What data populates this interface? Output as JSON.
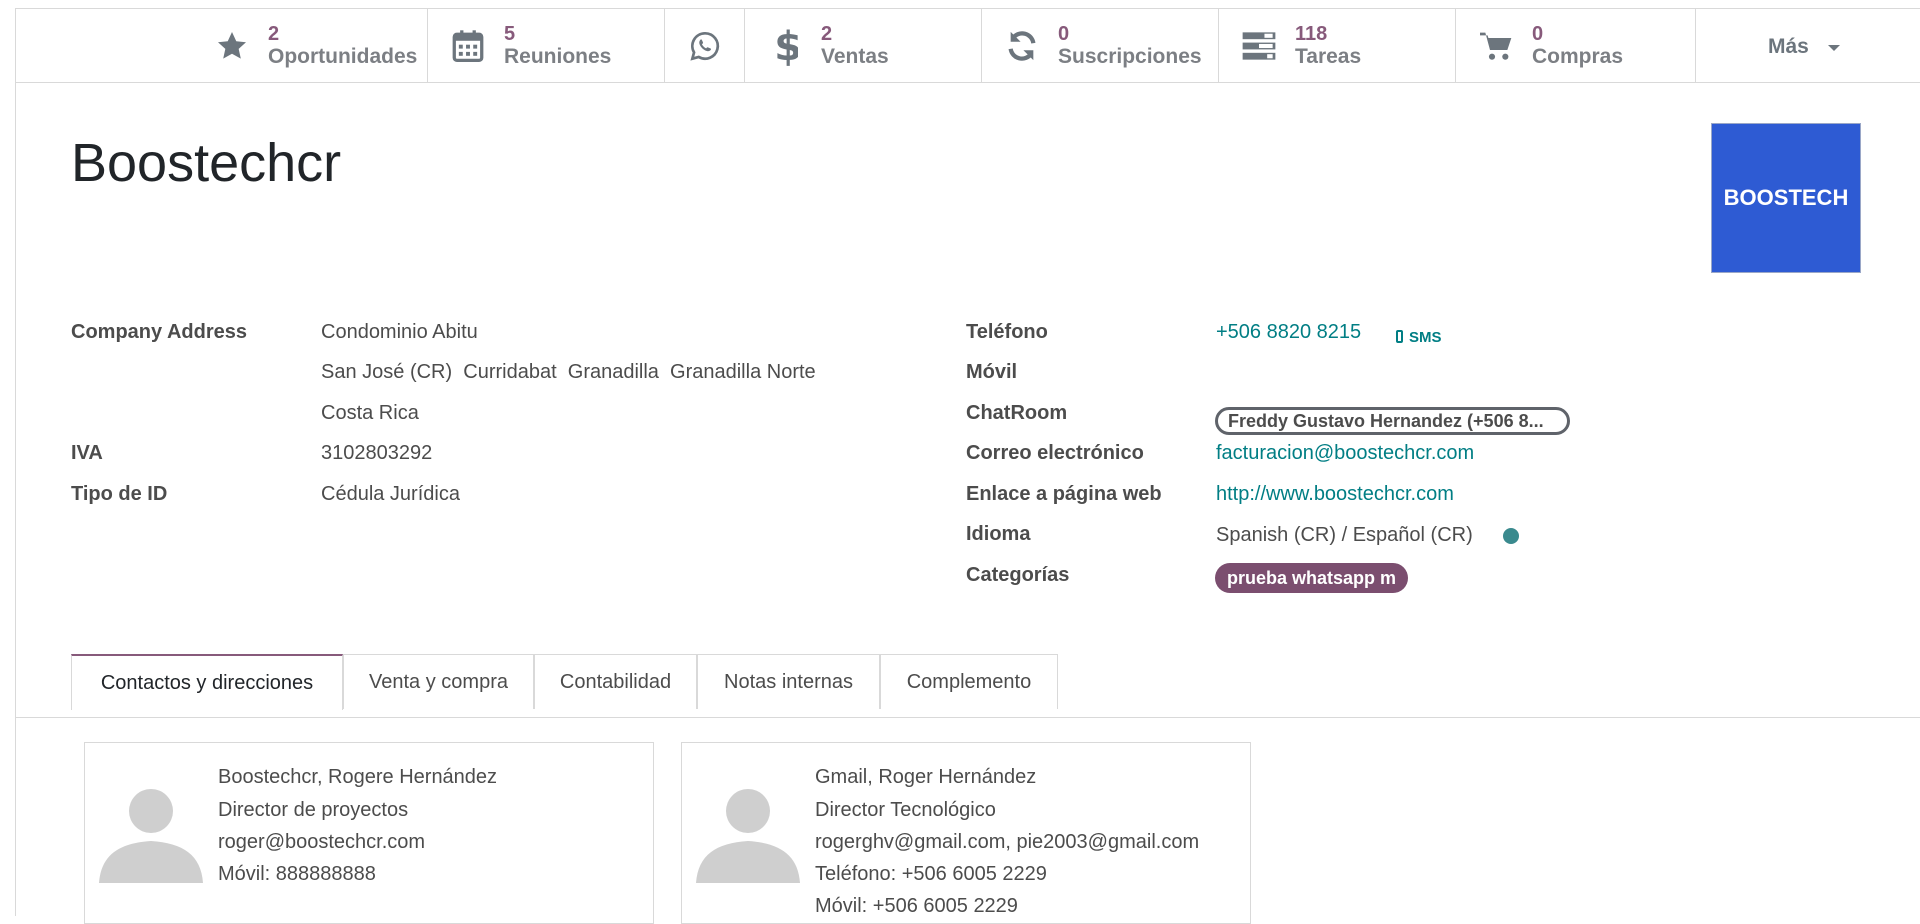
{
  "smart_buttons": [
    {
      "icon": "star-icon",
      "count": "2",
      "label": "Oportunidades"
    },
    {
      "icon": "calendar-icon",
      "count": "5",
      "label": "Reuniones"
    },
    {
      "icon": "whatsapp-icon",
      "count": "",
      "label": ""
    },
    {
      "icon": "dollar-icon",
      "count": "2",
      "label": "Ventas"
    },
    {
      "icon": "refresh-icon",
      "count": "0",
      "label": "Suscripciones"
    },
    {
      "icon": "tasks-icon",
      "count": "118",
      "label": "Tareas"
    },
    {
      "icon": "cart-icon",
      "count": "0",
      "label": "Compras"
    }
  ],
  "more_label": "Más",
  "title": "Boostechcr",
  "logo_text": "BOOSTECH",
  "left_fields": {
    "address_label": "Company Address",
    "address_line1": "Condominio Abitu",
    "address_line2": "San José (CR)  Curridabat  Granadilla  Granadilla Norte",
    "address_line3": "Costa Rica",
    "vat_label": "IVA",
    "vat_value": "3102803292",
    "idtype_label": "Tipo de ID",
    "idtype_value": "Cédula Jurídica"
  },
  "right_fields": {
    "phone_label": "Teléfono",
    "phone_value": "+506 8820 8215",
    "sms_label": "SMS",
    "mobile_label": "Móvil",
    "chatroom_label": "ChatRoom",
    "chatroom_value": "Freddy Gustavo Hernandez (+506 8...",
    "email_label": "Correo electrónico",
    "email_value": "facturacion@boostechcr.com",
    "website_label": "Enlace a página web",
    "website_value": "http://www.boostechcr.com",
    "lang_label": "Idioma",
    "lang_value": "Spanish (CR) / Español (CR)",
    "categories_label": "Categorías",
    "category_tag": "prueba whatsapp m"
  },
  "tabs": [
    "Contactos y direcciones",
    "Venta y compra",
    "Contabilidad",
    "Notas internas",
    "Complemento"
  ],
  "contacts": [
    {
      "name": "Boostechcr, Rogere Hernández",
      "job": "Director de proyectos",
      "email": "roger@boostechcr.com",
      "line4": "Móvil: 888888888",
      "line5": ""
    },
    {
      "name": "Gmail, Roger Hernández",
      "job": "Director Tecnológico",
      "email": "rogerghv@gmail.com, pie2003@gmail.com",
      "line4": "Teléfono: +506 6005 2229",
      "line5": "Móvil: +506 6005 2229"
    }
  ],
  "colors": {
    "accent": "#875a7b",
    "link": "#017e84",
    "logo_bg": "#2e5bd3",
    "tag_bg": "#7b4e6f"
  }
}
